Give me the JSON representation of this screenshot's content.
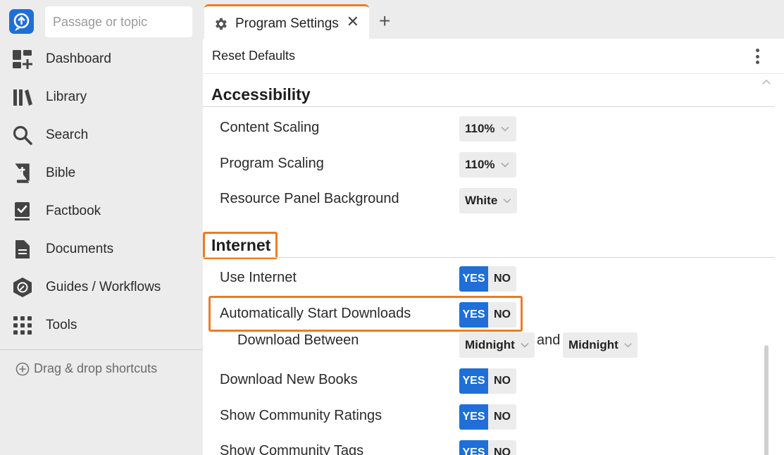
{
  "app": {
    "accent": "#1f6fd6",
    "highlight": "#f07a22"
  },
  "search": {
    "placeholder": "Passage or topic"
  },
  "sidebar": {
    "items": [
      {
        "label": "Dashboard",
        "icon": "dashboard-icon"
      },
      {
        "label": "Library",
        "icon": "library-icon"
      },
      {
        "label": "Search",
        "icon": "search-icon"
      },
      {
        "label": "Bible",
        "icon": "bible-icon"
      },
      {
        "label": "Factbook",
        "icon": "factbook-icon"
      },
      {
        "label": "Documents",
        "icon": "document-icon"
      },
      {
        "label": "Guides / Workflows",
        "icon": "guides-icon"
      },
      {
        "label": "Tools",
        "icon": "tools-grid-icon"
      }
    ],
    "shortcuts_label": "Drag & drop shortcuts"
  },
  "tabs": [
    {
      "label": "Program Settings",
      "icon": "gear-icon",
      "close": "✕"
    }
  ],
  "add_tab": "+",
  "toolbar": {
    "reset_label": "Reset Defaults"
  },
  "sections": {
    "accessibility": {
      "title": "Accessibility",
      "rows": [
        {
          "label": "Content Scaling",
          "value": "110%"
        },
        {
          "label": "Program Scaling",
          "value": "110%"
        },
        {
          "label": "Resource Panel Background",
          "value": "White"
        }
      ]
    },
    "internet": {
      "title": "Internet",
      "rows": [
        {
          "label": "Use Internet",
          "yes": "YES",
          "no": "NO",
          "selected": "YES"
        },
        {
          "label": "Automatically Start Downloads",
          "yes": "YES",
          "no": "NO",
          "selected": "YES"
        },
        {
          "label": "Download Between",
          "from": "Midnight",
          "and": "and",
          "to": "Midnight"
        },
        {
          "label": "Download New Books",
          "yes": "YES",
          "no": "NO",
          "selected": "YES"
        },
        {
          "label": "Show Community Ratings",
          "yes": "YES",
          "no": "NO",
          "selected": "YES"
        },
        {
          "label": "Show Community Tags",
          "yes": "YES",
          "no": "NO",
          "selected": "YES"
        }
      ]
    }
  }
}
